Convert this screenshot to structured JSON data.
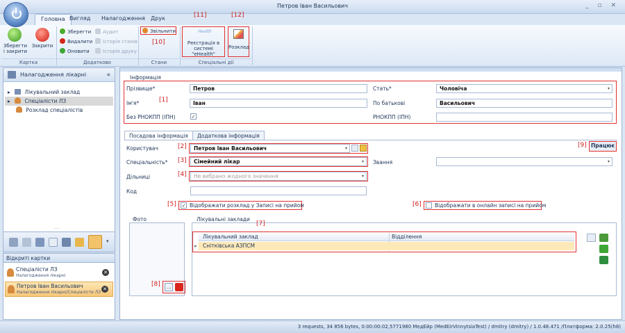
{
  "window": {
    "title": "Петров Іван Васильович",
    "controls": "_ ▫ ✕"
  },
  "ribbon_tabs": [
    "Головна",
    "Вигляд",
    "Налагодження",
    "Друк"
  ],
  "ribbon": {
    "save_close": "Зберегти і закрити",
    "close": "Закрити",
    "save": "Зберегти",
    "delete": "Видалити",
    "refresh": "Оновити",
    "audit": "Аудит",
    "state_history": "Історія станів",
    "print_history": "Історія друку",
    "release": "Звільнити",
    "ehealth_register": "Реєстрація в системі \"eHealth\"",
    "ehealth_logo": "Health",
    "schedule": "Розклад",
    "group_card": "Картка",
    "group_extra": "Додатково",
    "group_states": "Стани",
    "group_special": "Спеціальні дії"
  },
  "markers": {
    "m1": "[1]",
    "m2": "[2]",
    "m3": "[3]",
    "m4": "[4]",
    "m5": "[5]",
    "m6": "[6]",
    "m7": "[7]",
    "m8": "[8]",
    "m9": "[9]",
    "m10": "[10]",
    "m11": "[11]",
    "m12": "[12]"
  },
  "nav": {
    "title": "Налагодження лікарні",
    "collapse": "«",
    "items": [
      {
        "label": "Лікувальний заклад",
        "expander": "▸"
      },
      {
        "label": "Спеціалісти ЛЗ",
        "expander": "▸"
      },
      {
        "label": "Розклад спеціалістів",
        "expander": ""
      }
    ],
    "grip": "·····"
  },
  "open_cards": {
    "title": "Відкриті картки",
    "items": [
      {
        "title": "Спеціалісти ЛЗ",
        "subtitle": "Налагодження лікарні"
      },
      {
        "title": "Петров Іван Васильович",
        "subtitle": "Налагодження лікарні/Спеціалісти ЛЗ"
      }
    ],
    "close_glyph": "✕"
  },
  "info": {
    "section_label": "Інформація",
    "surname_label": "Прізвище*",
    "surname": "Петров",
    "name_label": "Ім'я*",
    "name": "Іван",
    "no_rnokpp_label": "Без РНОКПП (ІПН)",
    "no_rnokpp_check": "✓",
    "gender_label": "Стать*",
    "gender": "Чоловіча",
    "patronymic_label": "По батькові",
    "patronymic": "Васильович",
    "rnokpp_label": "РНОКПП (ІПН)",
    "rnokpp": ""
  },
  "tabs": [
    "Посадова інформація",
    "Додаткова інформація"
  ],
  "position": {
    "user_label": "Користувач",
    "user": "Петров Іван Васильович",
    "specialty_label": "Спеціальність*",
    "specialty": "Сімейний лікар",
    "rank_label": "Звання",
    "rank": "",
    "districts_label": "Дільниці",
    "districts_placeholder": "Не вибрано жодного значення",
    "code_label": "Код",
    "code": "",
    "status_badge": "Працює",
    "show_schedule_label": "Відображати розклад у Записі на прийом",
    "show_schedule_check": "✓",
    "show_online_label": "Відображати в онлайн записі на прийом",
    "photo_label": "Фото",
    "photo_browse": "...",
    "facilities_label": "Лікувальні заклади",
    "grid_headers": [
      "Лікувальний заклад",
      "Відділення"
    ],
    "grid_rows": [
      {
        "facility": "Снітківська АЗПСМ",
        "department": ""
      }
    ],
    "row_indicator": "▸"
  },
  "statusbar": "3 requests, 34 856 bytes, 0:00:00:02,5771980  МедЕйр (MedEirVinnytsiaTest) / dmitry (dmitry) / 1.0.48.471 /Платформа: 2.0.25(h8)",
  "colors": {
    "accent": "#f6c36c",
    "marker": "#e03030",
    "selection": "#fde9b8"
  }
}
